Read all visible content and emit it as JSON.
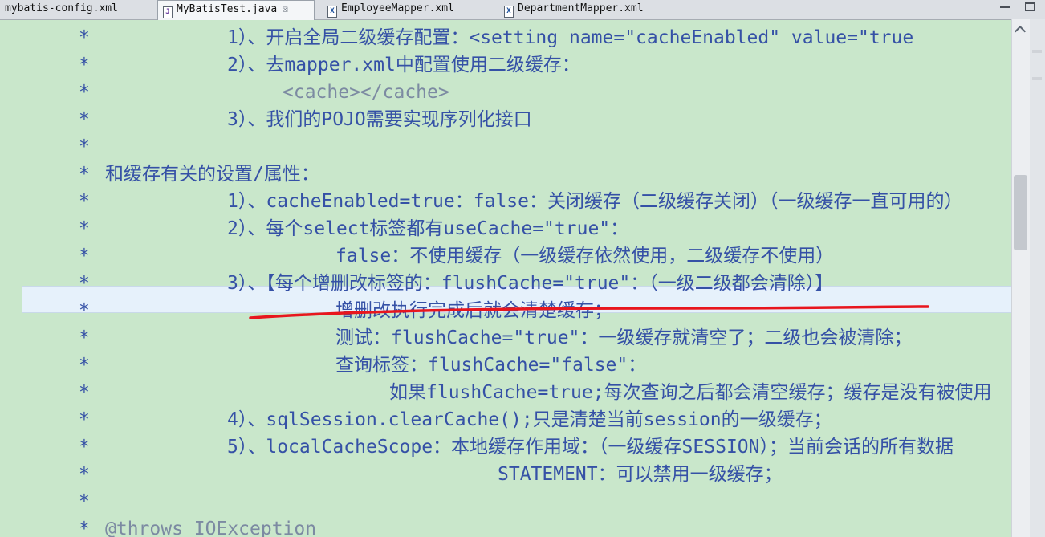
{
  "tabs": [
    {
      "label": "mybatis-config.xml",
      "icon": "xml-file-icon",
      "active": false
    },
    {
      "label": "MyBatisTest.java",
      "icon": "java-file-icon",
      "active": true,
      "close": "☒"
    },
    {
      "label": "EmployeeMapper.xml",
      "icon": "xml-file-icon",
      "active": false
    },
    {
      "label": "DepartmentMapper.xml",
      "icon": "xml-file-icon",
      "active": false
    }
  ],
  "editor": {
    "star": "*",
    "lines": [
      "1）、开启全局二级缓存配置：<setting name=\"cacheEnabled\" value=\"true",
      "2）、去mapper.xml中配置使用二级缓存：",
      "<cache></cache>",
      "3）、我们的POJO需要实现序列化接口",
      "",
      "和缓存有关的设置/属性：",
      "1）、cacheEnabled=true：false：关闭缓存（二级缓存关闭）（一级缓存一直可用的）",
      "2）、每个select标签都有useCache=\"true\"：",
      "false：不使用缓存（一级缓存依然使用，二级缓存不使用）",
      "3）、【每个增删改标签的：flushCache=\"true\"：（一级二级都会清除）】",
      "增删改执行完成后就会清楚缓存；",
      "测试：flushCache=\"true\"：一级缓存就清空了；二级也会被清除；",
      "查询标签：flushCache=\"false\"：",
      "如果flushCache=true;每次查询之后都会清空缓存；缓存是没有被使用",
      "4）、sqlSession.clearCache();只是清楚当前session的一级缓存；",
      "5）、localCacheScope：本地缓存作用域：（一级缓存SESSION）；当前会话的所有数据",
      "STATEMENT：可以禁用一级缓存；",
      "",
      "@throws IOException"
    ]
  },
  "colors": {
    "background": "#c9e7cb",
    "text": "#3551a6",
    "annotation_red": "#e8161d"
  }
}
